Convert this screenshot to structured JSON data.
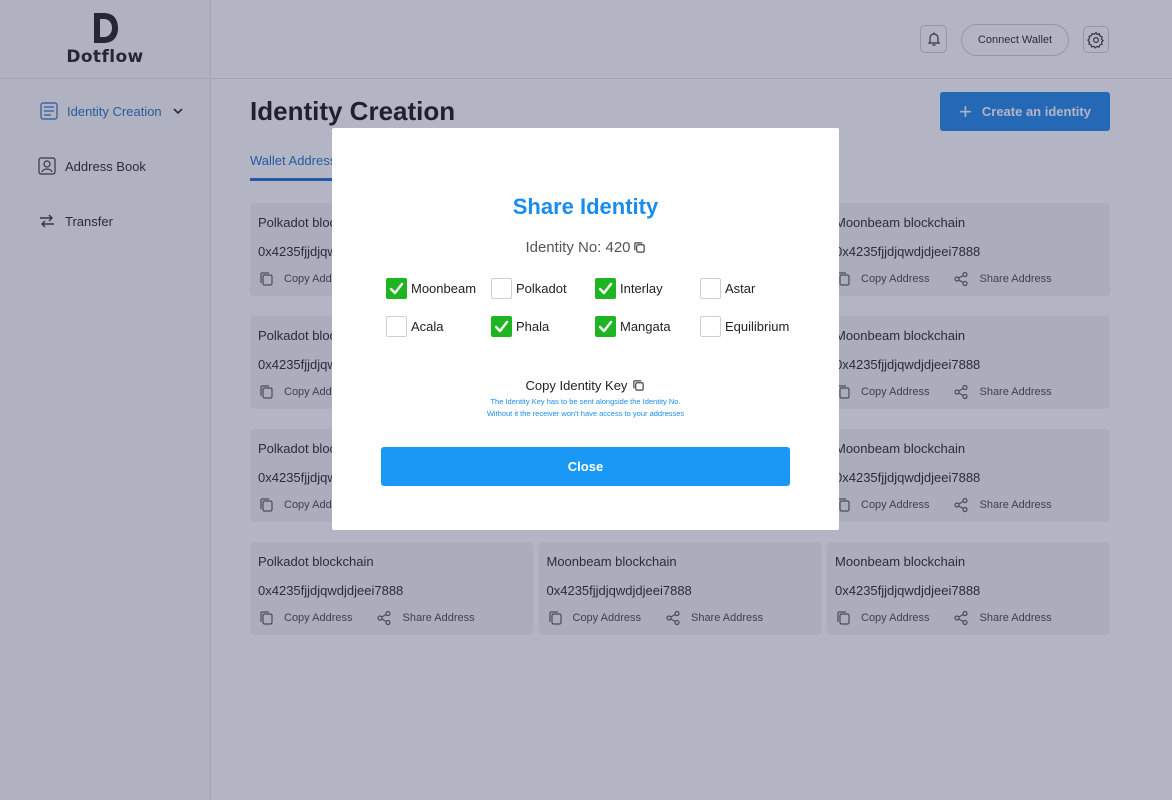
{
  "app": {
    "brand": "Dotflow"
  },
  "sidebar": {
    "items": [
      {
        "label": "Identity Creation",
        "icon": "identity-icon"
      },
      {
        "label": "Address Book",
        "icon": "address-book-icon"
      },
      {
        "label": "Transfer",
        "icon": "transfer-icon"
      }
    ]
  },
  "header": {
    "connect_wallet": "Connect Wallet"
  },
  "main": {
    "title": "Identity Creation",
    "create_button": "Create an identity",
    "tab": "Wallet Address",
    "copy_label": "Copy Address",
    "share_label": "Share Address",
    "cards": [
      {
        "chain": "Polkadot blockchain",
        "address": "0x4235fjjdjqwdjdjeei7888"
      },
      {
        "chain": "Moonbeam blockchain",
        "address": "0x4235fjjdjqwdjdjeei7888"
      },
      {
        "chain": "Moonbeam blockchain",
        "address": "0x4235fjjdjqwdjdjeei7888"
      },
      {
        "chain": "Polkadot blockchain",
        "address": "0x4235fjjdjqwdjdjeei7888"
      },
      {
        "chain": "Moonbeam blockchain",
        "address": "0x4235fjjdjqwdjdjeei7888"
      },
      {
        "chain": "Moonbeam blockchain",
        "address": "0x4235fjjdjqwdjdjeei7888"
      },
      {
        "chain": "Polkadot blockchain",
        "address": "0x4235fjjdjqwdjdjeei7888"
      },
      {
        "chain": "Moonbeam blockchain",
        "address": "0x4235fjjdjqwdjdjeei7888"
      },
      {
        "chain": "Moonbeam blockchain",
        "address": "0x4235fjjdjqwdjdjeei7888"
      },
      {
        "chain": "Polkadot blockchain",
        "address": "0x4235fjjdjqwdjdjeei7888"
      },
      {
        "chain": "Moonbeam blockchain",
        "address": "0x4235fjjdjqwdjdjeei7888"
      },
      {
        "chain": "Moonbeam blockchain",
        "address": "0x4235fjjdjqwdjdjeei7888"
      }
    ]
  },
  "modal": {
    "title": "Share Identity",
    "identity_no": "Identity No: 420",
    "chains": [
      {
        "label": "Moonbeam",
        "checked": true
      },
      {
        "label": "Polkadot",
        "checked": false
      },
      {
        "label": "Interlay",
        "checked": true
      },
      {
        "label": "Astar",
        "checked": false
      },
      {
        "label": "Acala",
        "checked": false
      },
      {
        "label": "Phala",
        "checked": true
      },
      {
        "label": "Mangata",
        "checked": true
      },
      {
        "label": "Equilibrium",
        "checked": false
      }
    ],
    "copy_key": "Copy Identity Key",
    "note_line1": "The Identity Key has to be sent alongside the Identity No.",
    "note_line2": "Without it the receiver won't have access to your addresses",
    "close": "Close"
  },
  "colors": {
    "accent": "#1a8cf0",
    "primary_button": "#1b85e8",
    "check_green": "#1fb421",
    "overlay": "rgba(55,58,100,0.38)"
  }
}
